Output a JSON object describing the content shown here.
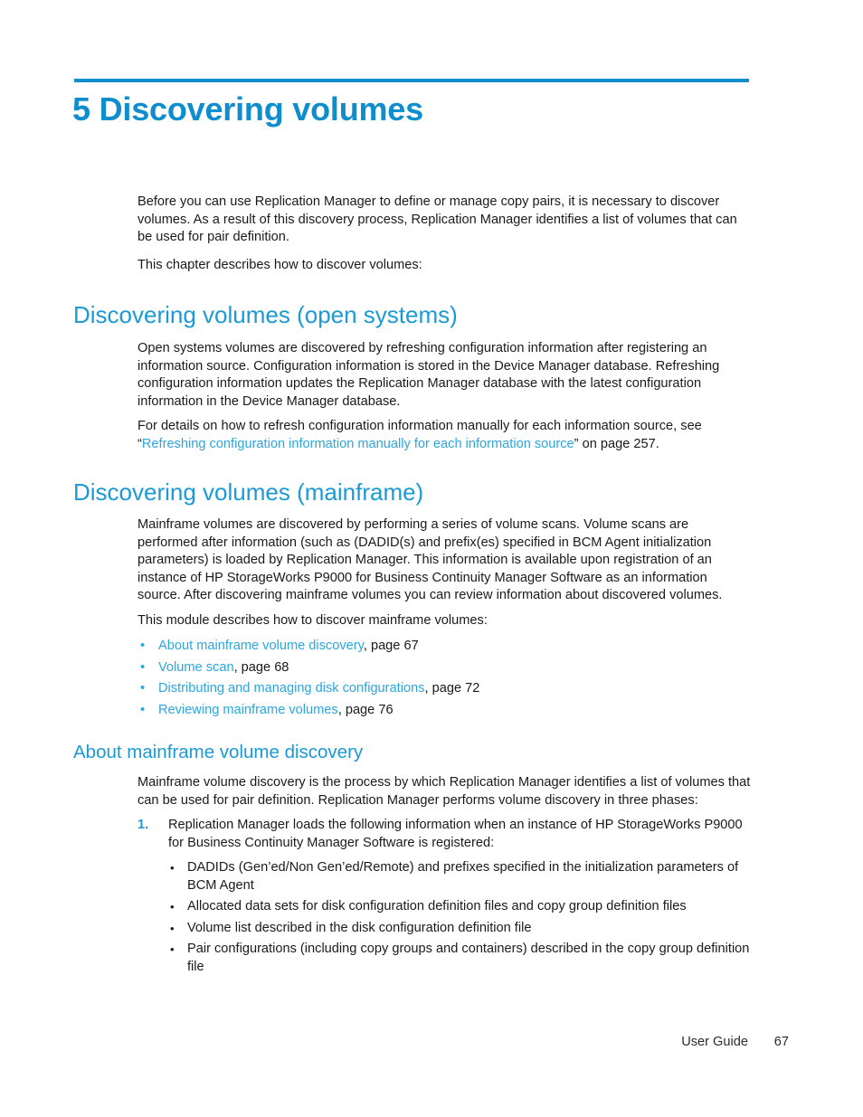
{
  "chapter": {
    "number_and_title": "5 Discovering volumes"
  },
  "intro": {
    "paragraph1": "Before you can use Replication Manager to define or manage copy pairs, it is necessary to discover volumes. As a result of this discovery process, Replication Manager identifies a list of volumes that can be used for pair definition.",
    "paragraph2": "This chapter describes how to discover volumes:"
  },
  "section_open_systems": {
    "heading": "Discovering volumes (open systems)",
    "paragraph1": "Open systems volumes are discovered by refreshing configuration information after registering an information source. Configuration information is stored in the Device Manager database. Refreshing configuration information updates the Replication Manager database with the latest configuration information in the Device Manager database.",
    "paragraph2_before": "For details on how to refresh configuration information manually for each information source, see “",
    "paragraph2_link": "Refreshing configuration information manually for each information source",
    "paragraph2_after": "” on page 257."
  },
  "section_mainframe": {
    "heading": "Discovering volumes (mainframe)",
    "paragraph1": "Mainframe volumes are discovered by performing a series of volume scans. Volume scans are performed after information (such as (DADID(s) and prefix(es) specified in BCM Agent initialization parameters) is loaded by Replication Manager. This information is available upon registration of an instance of HP StorageWorks P9000 for Business Continuity Manager Software as an information source. After discovering mainframe volumes you can review information about discovered volumes.",
    "paragraph2": "This module describes how to discover mainframe volumes:",
    "bullet_marker": "•",
    "cross_references": [
      {
        "link": "About mainframe volume discovery",
        "suffix": ", page 67"
      },
      {
        "link": "Volume scan",
        "suffix": ", page 68"
      },
      {
        "link": "Distributing and managing disk configurations",
        "suffix": ", page 72"
      },
      {
        "link": "Reviewing mainframe volumes",
        "suffix": ", page 76"
      }
    ]
  },
  "section_about_discovery": {
    "heading": "About mainframe volume discovery",
    "paragraph1": "Mainframe volume discovery is the process by which Replication Manager identifies a list of volumes that can be used for pair definition. Replication Manager performs volume discovery in three phases:",
    "step1_marker": "1.",
    "step1_text": "Replication Manager loads the following information when an instance of HP StorageWorks P9000 for Business Continuity Manager Software is registered:",
    "sub_bullet_marker": "•",
    "step1_subitems": [
      "DADIDs (Gen’ed/Non Gen’ed/Remote) and prefixes specified in the initialization parameters of BCM Agent",
      "Allocated data sets for disk configuration definition files and copy group definition files",
      "Volume list described in the disk configuration definition file",
      "Pair configurations (including copy groups and containers) described in the copy group definition file"
    ]
  },
  "footer": {
    "label": "User Guide",
    "page_number": "67"
  },
  "colors": {
    "chapter_blue": "#0e8ecd",
    "heading_blue": "#1b9ad6",
    "link_blue": "#2ba6de",
    "body_text": "#1a1a1a"
  }
}
